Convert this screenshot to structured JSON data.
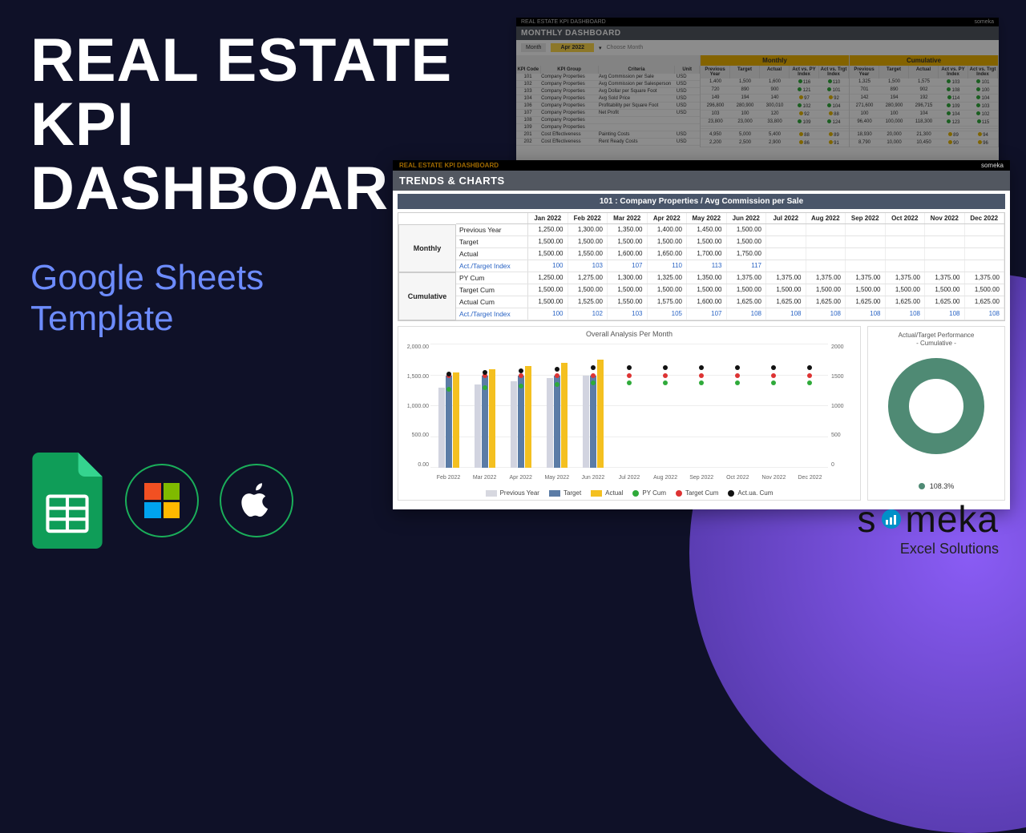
{
  "hero": {
    "title_l1": "REAL ESTATE",
    "title_l2": "KPI",
    "title_l3": "DASHBOARD",
    "sub_l1": "Google Sheets",
    "sub_l2": "Template"
  },
  "brand": {
    "name": "someka",
    "sub": "Excel Solutions"
  },
  "monthly": {
    "product": "REAL ESTATE KPI DASHBOARD",
    "wm": "someka",
    "band": "MONTHLY DASHBOARD",
    "month_label": "Month",
    "month_value": "Apr 2022",
    "choose": "Choose Month",
    "block1_title": "Monthly",
    "block2_title": "Cumulative",
    "left_cols": [
      "KPI Code",
      "KPI Group",
      "Criteria",
      "Unit"
    ],
    "block_cols": [
      "Previous Year",
      "Target",
      "Actual",
      "Act vs. PY Index",
      "Act vs. Trgt Index"
    ],
    "rows": [
      {
        "code": "101",
        "grp": "Company Properties",
        "crit": "Avg Commission per Sale",
        "unit": "USD",
        "m": [
          1400,
          1500,
          1600,
          116,
          110
        ],
        "c": [
          1325,
          1500,
          1575,
          103,
          101
        ]
      },
      {
        "code": "102",
        "grp": "Company Properties",
        "crit": "Avg Commission per Salesperson",
        "unit": "USD",
        "m": [
          720,
          890,
          900,
          121,
          101
        ],
        "c": [
          701,
          890,
          902,
          108,
          100
        ]
      },
      {
        "code": "103",
        "grp": "Company Properties",
        "crit": "Avg Dollar per Square Foot",
        "unit": "USD",
        "m": [
          149,
          194,
          140,
          97,
          92
        ],
        "c": [
          142,
          194,
          192,
          114,
          104
        ]
      },
      {
        "code": "104",
        "grp": "Company Properties",
        "crit": "Avg Sold Price",
        "unit": "USD",
        "m": [
          296800,
          280900,
          300010,
          102,
          104
        ],
        "c": [
          271600,
          280900,
          296715,
          109,
          103
        ]
      },
      {
        "code": "106",
        "grp": "Company Properties",
        "crit": "Profitability per Square Foot",
        "unit": "USD",
        "m": [
          103,
          100,
          120,
          92,
          88
        ],
        "c": [
          100,
          100,
          104,
          104,
          102
        ]
      },
      {
        "code": "107",
        "grp": "Company Properties",
        "crit": "Net Profit",
        "unit": "USD",
        "m": [
          23800,
          23000,
          33800,
          109,
          124
        ],
        "c": [
          96400,
          100000,
          118300,
          123,
          115
        ]
      },
      {
        "code": "108",
        "grp": "Company Properties",
        "crit": "",
        "unit": "",
        "m": [
          "",
          "",
          "",
          "",
          ""
        ],
        "c": [
          "",
          "",
          "",
          "",
          ""
        ]
      },
      {
        "code": "109",
        "grp": "Company Properties",
        "crit": "",
        "unit": "",
        "m": [
          "",
          "",
          "",
          "",
          ""
        ],
        "c": [
          "",
          "",
          "",
          "",
          ""
        ]
      },
      {
        "code": "201",
        "grp": "Cost Effectiveness",
        "crit": "Painting Costs",
        "unit": "USD",
        "m": [
          4950,
          5000,
          5400,
          88,
          89
        ],
        "c": [
          18930,
          20000,
          21300,
          89,
          94
        ]
      },
      {
        "code": "202",
        "grp": "Cost Effectiveness",
        "crit": "Rent Ready Costs",
        "unit": "USD",
        "m": [
          2200,
          2500,
          2900,
          86,
          91
        ],
        "c": [
          8790,
          10000,
          10450,
          90,
          96
        ]
      }
    ]
  },
  "trends": {
    "product": "REAL ESTATE KPI DASHBOARD",
    "wm": "someka",
    "band": "TRENDS & CHARTS",
    "kpi_title": "101 : Company Properties / Avg Commission per Sale",
    "months": [
      "Jan 2022",
      "Feb 2022",
      "Mar 2022",
      "Apr 2022",
      "May 2022",
      "Jun 2022",
      "Jul 2022",
      "Aug 2022",
      "Sep 2022",
      "Oct 2022",
      "Nov 2022",
      "Dec 2022"
    ],
    "group_monthly": "Monthly",
    "group_cum": "Cumulative",
    "rows_monthly": [
      {
        "label": "Previous Year",
        "vals": [
          "1,250.00",
          "1,300.00",
          "1,350.00",
          "1,400.00",
          "1,450.00",
          "1,500.00",
          "",
          "",
          "",
          "",
          "",
          ""
        ]
      },
      {
        "label": "Target",
        "vals": [
          "1,500.00",
          "1,500.00",
          "1,500.00",
          "1,500.00",
          "1,500.00",
          "1,500.00",
          "",
          "",
          "",
          "",
          "",
          ""
        ]
      },
      {
        "label": "Actual",
        "vals": [
          "1,500.00",
          "1,550.00",
          "1,600.00",
          "1,650.00",
          "1,700.00",
          "1,750.00",
          "",
          "",
          "",
          "",
          "",
          ""
        ]
      },
      {
        "label": "Act./Target Index",
        "cls": "bl",
        "vals": [
          "100",
          "103",
          "107",
          "110",
          "113",
          "117",
          "",
          "",
          "",
          "",
          "",
          ""
        ]
      }
    ],
    "rows_cum": [
      {
        "label": "PY Cum",
        "vals": [
          "1,250.00",
          "1,275.00",
          "1,300.00",
          "1,325.00",
          "1,350.00",
          "1,375.00",
          "1,375.00",
          "1,375.00",
          "1,375.00",
          "1,375.00",
          "1,375.00",
          "1,375.00"
        ]
      },
      {
        "label": "Target Cum",
        "vals": [
          "1,500.00",
          "1,500.00",
          "1,500.00",
          "1,500.00",
          "1,500.00",
          "1,500.00",
          "1,500.00",
          "1,500.00",
          "1,500.00",
          "1,500.00",
          "1,500.00",
          "1,500.00"
        ]
      },
      {
        "label": "Actual Cum",
        "vals": [
          "1,500.00",
          "1,525.00",
          "1,550.00",
          "1,575.00",
          "1,600.00",
          "1,625.00",
          "1,625.00",
          "1,625.00",
          "1,625.00",
          "1,625.00",
          "1,625.00",
          "1,625.00"
        ]
      },
      {
        "label": "Act./Target Index",
        "cls": "bl",
        "vals": [
          "100",
          "102",
          "103",
          "105",
          "107",
          "108",
          "108",
          "108",
          "108",
          "108",
          "108",
          "108"
        ]
      }
    ],
    "chart_main_title": "Overall Analysis Per Month",
    "y_left": [
      "2,000.00",
      "1,500.00",
      "1,000.00",
      "500.00",
      "0.00"
    ],
    "y_right": [
      "2000",
      "1500",
      "1000",
      "500",
      "0"
    ],
    "x_labels": [
      "Feb 2022",
      "Mar 2022",
      "Apr 2022",
      "May 2022",
      "Jun 2022",
      "Jul 2022",
      "Aug 2022",
      "Sep 2022",
      "Oct 2022",
      "Nov 2022",
      "Dec 2022"
    ],
    "legend": {
      "prev": "Previous Year",
      "tgt": "Target",
      "act": "Actual",
      "py": "PY Cum",
      "tc": "Target Cum",
      "ac": "Act.ua. Cum"
    },
    "donut_title_l1": "Actual/Target Performance",
    "donut_title_l2": "- Cumulative -",
    "donut_value": "108.3%"
  },
  "chart_data": [
    {
      "type": "bar",
      "title": "Overall Analysis Per Month",
      "categories": [
        "Feb 2022",
        "Mar 2022",
        "Apr 2022",
        "May 2022",
        "Jun 2022",
        "Jul 2022",
        "Aug 2022",
        "Sep 2022",
        "Oct 2022",
        "Nov 2022",
        "Dec 2022"
      ],
      "series": [
        {
          "name": "Previous Year",
          "values": [
            1300,
            1350,
            1400,
            1450,
            1500,
            null,
            null,
            null,
            null,
            null,
            null
          ]
        },
        {
          "name": "Target",
          "values": [
            1500,
            1500,
            1500,
            1500,
            1500,
            null,
            null,
            null,
            null,
            null,
            null
          ]
        },
        {
          "name": "Actual",
          "values": [
            1550,
            1600,
            1650,
            1700,
            1750,
            null,
            null,
            null,
            null,
            null,
            null
          ]
        },
        {
          "name": "PY Cum",
          "type": "line",
          "values": [
            1275,
            1300,
            1325,
            1350,
            1375,
            1375,
            1375,
            1375,
            1375,
            1375,
            1375
          ]
        },
        {
          "name": "Target Cum",
          "type": "line",
          "values": [
            1500,
            1500,
            1500,
            1500,
            1500,
            1500,
            1500,
            1500,
            1500,
            1500,
            1500
          ]
        },
        {
          "name": "Actual Cum",
          "type": "line",
          "values": [
            1525,
            1550,
            1575,
            1600,
            1625,
            1625,
            1625,
            1625,
            1625,
            1625,
            1625
          ]
        }
      ],
      "ylim": [
        0,
        2000
      ],
      "ylabel": "",
      "xlabel": "",
      "secondary_ylim": [
        0,
        2000
      ]
    },
    {
      "type": "pie",
      "title": "Actual/Target Performance - Cumulative",
      "categories": [
        "Actual/Target"
      ],
      "values": [
        108.3
      ],
      "unit": "%"
    }
  ]
}
